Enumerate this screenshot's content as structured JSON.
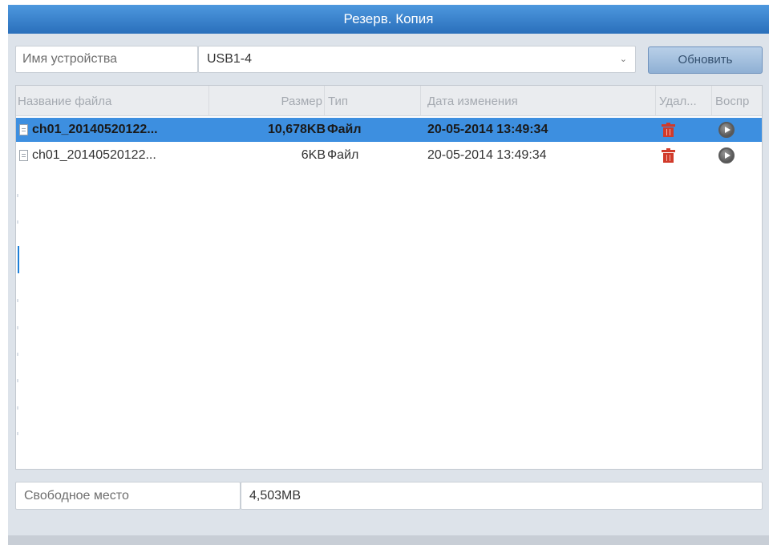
{
  "window": {
    "title": "Резерв. Копия"
  },
  "device": {
    "label": "Имя устройства",
    "value": "USB1-4",
    "refresh_label": "Обновить"
  },
  "table": {
    "headers": {
      "name": "Название файла",
      "size": "Размер",
      "type": "Тип",
      "modified": "Дата изменения",
      "delete": "Удал...",
      "play": "Воспр"
    },
    "rows": [
      {
        "name": "ch01_20140520122...",
        "size": "10,678KB",
        "type": "Файл",
        "modified": "20-05-2014 13:49:34",
        "selected": true
      },
      {
        "name": "ch01_20140520122...",
        "size": "6KB",
        "type": "Файл",
        "modified": "20-05-2014 13:49:34",
        "selected": false
      }
    ]
  },
  "free_space": {
    "label": "Свободное место",
    "value": "4,503MB"
  },
  "colors": {
    "title_bar": "#2a6fbb",
    "selected_row": "#3d8fe0",
    "delete_icon": "#d13a2a"
  },
  "icons": {
    "row_file": "file-icon",
    "row_delete": "trash-icon",
    "row_play": "play-icon"
  }
}
